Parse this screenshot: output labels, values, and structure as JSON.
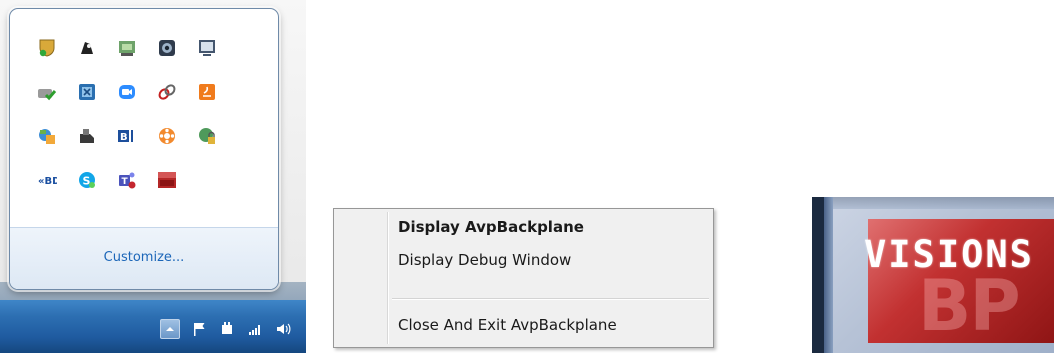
{
  "tray_flyout": {
    "icons": [
      "security-shield-icon",
      "printer-ink-icon",
      "network-drive-icon",
      "webcam-icon",
      "monitor-icon",
      "sync-check-icon",
      "excel-addin-icon",
      "zoom-video-icon",
      "link-chain-icon",
      "java-update-icon",
      "teams-meeting-icon",
      "storage-drive-icon",
      "bluetooth-b-icon",
      "snowflake-app-icon",
      "vpn-lock-icon",
      "bd-player-icon",
      "skype-icon",
      "teams-icon",
      "visions-bp-icon"
    ],
    "customize_label": "Customize..."
  },
  "context_menu": {
    "items": [
      "Display AvpBackplane",
      "Display Debug Window",
      "Close And Exit AvpBackplane"
    ]
  },
  "zoom_icon": {
    "top_text": "VISIONS",
    "bottom_text": "BP"
  },
  "colors": {
    "taskbar": "#1f5ba0",
    "link": "#1c66b8",
    "bp_red": "#c23131"
  }
}
